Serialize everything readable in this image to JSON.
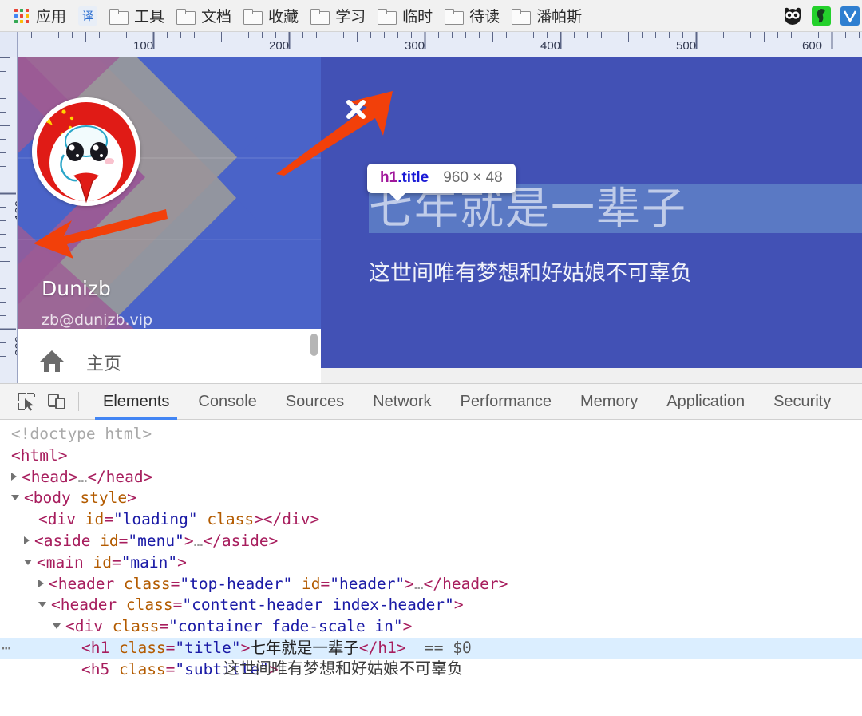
{
  "browser": {
    "bookmarks": [
      {
        "label": "应用",
        "icon": "apps-grid-icon"
      },
      {
        "label": "",
        "icon": "translate-icon"
      },
      {
        "label": "工具",
        "icon": "folder-icon"
      },
      {
        "label": "文档",
        "icon": "folder-icon"
      },
      {
        "label": "收藏",
        "icon": "folder-icon"
      },
      {
        "label": "学习",
        "icon": "folder-icon"
      },
      {
        "label": "临时",
        "icon": "folder-icon"
      },
      {
        "label": "待读",
        "icon": "folder-icon"
      },
      {
        "label": "潘帕斯",
        "icon": "folder-icon"
      }
    ],
    "extensions": [
      {
        "name": "owl-extension-icon",
        "color": "#1b1b1b"
      },
      {
        "name": "evernote-extension-icon",
        "color": "#24d12c"
      },
      {
        "name": "blue-extension-icon",
        "color": "#2f7fd0"
      }
    ]
  },
  "rulers": {
    "horizontal_labels": [
      "100",
      "200",
      "300",
      "400",
      "500",
      "600"
    ],
    "vertical_labels": [
      "100",
      "200"
    ],
    "unit_step": 100,
    "minor_step": 10
  },
  "page": {
    "sidebar": {
      "username": "Dunizb",
      "email": "zb@dunizb.vip",
      "avatar_name": "cartoon-avatar",
      "menu": [
        {
          "icon": "home-icon",
          "label": "主页"
        }
      ]
    },
    "content": {
      "title": "七年就是一辈子",
      "subtitle": "这世间唯有梦想和好姑娘不可辜负",
      "background_color": "#4251b5",
      "highlight_color": "rgba(120,170,215,0.45)"
    }
  },
  "inspector_badge": {
    "tag": "h1",
    "class": ".title",
    "dimensions": "960 × 48",
    "tag_color": "#a1179b",
    "class_color": "#1a1ad6"
  },
  "annotations": [
    {
      "name": "close-x-marker",
      "type": "x-mark",
      "color": "#ffffff"
    },
    {
      "name": "arrow-to-close",
      "type": "arrow",
      "color": "#f2400a",
      "direction": "up-right"
    },
    {
      "name": "arrow-to-avatar",
      "type": "arrow",
      "color": "#f2400a",
      "direction": "left"
    }
  ],
  "devtools": {
    "tools": [
      {
        "name": "inspect-element-icon"
      },
      {
        "name": "device-toolbar-icon"
      }
    ],
    "tabs": [
      {
        "label": "Elements",
        "active": true
      },
      {
        "label": "Console",
        "active": false
      },
      {
        "label": "Sources",
        "active": false
      },
      {
        "label": "Network",
        "active": false
      },
      {
        "label": "Performance",
        "active": false
      },
      {
        "label": "Memory",
        "active": false
      },
      {
        "label": "Application",
        "active": false
      },
      {
        "label": "Security",
        "active": false
      }
    ],
    "active_tab_underline_color": "#4285f4",
    "dom_lines": [
      {
        "indent": 0,
        "tri": "none",
        "parts": [
          {
            "c": "c-doctype",
            "t": "<!doctype html>"
          }
        ]
      },
      {
        "indent": 0,
        "tri": "none",
        "parts": [
          {
            "c": "c-tag",
            "t": "<html>"
          }
        ]
      },
      {
        "indent": 0,
        "tri": "closed",
        "parts": [
          {
            "c": "c-tag",
            "t": "<head>"
          },
          {
            "c": "c-dim",
            "t": "…"
          },
          {
            "c": "c-tag",
            "t": "</head>"
          }
        ]
      },
      {
        "indent": 0,
        "tri": "open",
        "parts": [
          {
            "c": "c-tag",
            "t": "<body "
          },
          {
            "c": "c-attr",
            "t": "style"
          },
          {
            "c": "c-tag",
            "t": ">"
          }
        ]
      },
      {
        "indent": 2,
        "tri": "none",
        "parts": [
          {
            "c": "c-tag",
            "t": "<div "
          },
          {
            "c": "c-attr",
            "t": "id"
          },
          {
            "c": "c-tag",
            "t": "="
          },
          {
            "c": "c-val",
            "t": "\"loading\""
          },
          {
            "c": "c-tag",
            "t": " "
          },
          {
            "c": "c-attr",
            "t": "class"
          },
          {
            "c": "c-tag",
            "t": "></div>"
          }
        ]
      },
      {
        "indent": 1,
        "tri": "closed",
        "parts": [
          {
            "c": "c-tag",
            "t": "<aside "
          },
          {
            "c": "c-attr",
            "t": "id"
          },
          {
            "c": "c-tag",
            "t": "="
          },
          {
            "c": "c-val",
            "t": "\"menu\""
          },
          {
            "c": "c-tag",
            "t": ">"
          },
          {
            "c": "c-dim",
            "t": "…"
          },
          {
            "c": "c-tag",
            "t": "</aside>"
          }
        ]
      },
      {
        "indent": 1,
        "tri": "open",
        "parts": [
          {
            "c": "c-tag",
            "t": "<main "
          },
          {
            "c": "c-attr",
            "t": "id"
          },
          {
            "c": "c-tag",
            "t": "="
          },
          {
            "c": "c-val",
            "t": "\"main\""
          },
          {
            "c": "c-tag",
            "t": ">"
          }
        ]
      },
      {
        "indent": 2,
        "tri": "closed",
        "parts": [
          {
            "c": "c-tag",
            "t": "<header "
          },
          {
            "c": "c-attr",
            "t": "class"
          },
          {
            "c": "c-tag",
            "t": "="
          },
          {
            "c": "c-val",
            "t": "\"top-header\""
          },
          {
            "c": "c-tag",
            "t": " "
          },
          {
            "c": "c-attr",
            "t": "id"
          },
          {
            "c": "c-tag",
            "t": "="
          },
          {
            "c": "c-val",
            "t": "\"header\""
          },
          {
            "c": "c-tag",
            "t": ">"
          },
          {
            "c": "c-dim",
            "t": "…"
          },
          {
            "c": "c-tag",
            "t": "</header>"
          }
        ]
      },
      {
        "indent": 2,
        "tri": "open",
        "parts": [
          {
            "c": "c-tag",
            "t": "<header "
          },
          {
            "c": "c-attr",
            "t": "class"
          },
          {
            "c": "c-tag",
            "t": "="
          },
          {
            "c": "c-val",
            "t": "\"content-header index-header\""
          },
          {
            "c": "c-tag",
            "t": ">"
          }
        ]
      },
      {
        "indent": 3,
        "tri": "open",
        "parts": [
          {
            "c": "c-tag",
            "t": "<div "
          },
          {
            "c": "c-attr",
            "t": "class"
          },
          {
            "c": "c-tag",
            "t": "="
          },
          {
            "c": "c-val",
            "t": "\"container fade-scale in\""
          },
          {
            "c": "c-tag",
            "t": ">"
          }
        ]
      },
      {
        "indent": 5,
        "tri": "none",
        "selected": true,
        "parts": [
          {
            "c": "c-tag",
            "t": "<h1 "
          },
          {
            "c": "c-attr",
            "t": "class"
          },
          {
            "c": "c-tag",
            "t": "="
          },
          {
            "c": "c-val",
            "t": "\"title\""
          },
          {
            "c": "c-tag",
            "t": ">"
          },
          {
            "c": "c-txt",
            "t": "七年就是一辈子"
          },
          {
            "c": "c-tag",
            "t": "</h1>"
          },
          {
            "c": "c-dollar",
            "t": "  == $0"
          }
        ]
      },
      {
        "indent": 5,
        "tri": "none",
        "parts": [
          {
            "c": "c-tag",
            "t": "<h5 "
          },
          {
            "c": "c-attr",
            "t": "class"
          },
          {
            "c": "c-tag",
            "t": "="
          },
          {
            "c": "c-val",
            "t": "\"subtitle\""
          },
          {
            "c": "c-tag",
            "t": ">"
          }
        ]
      }
    ],
    "overflow_text": "这世间唯有梦想和好姑娘不可辜负"
  }
}
